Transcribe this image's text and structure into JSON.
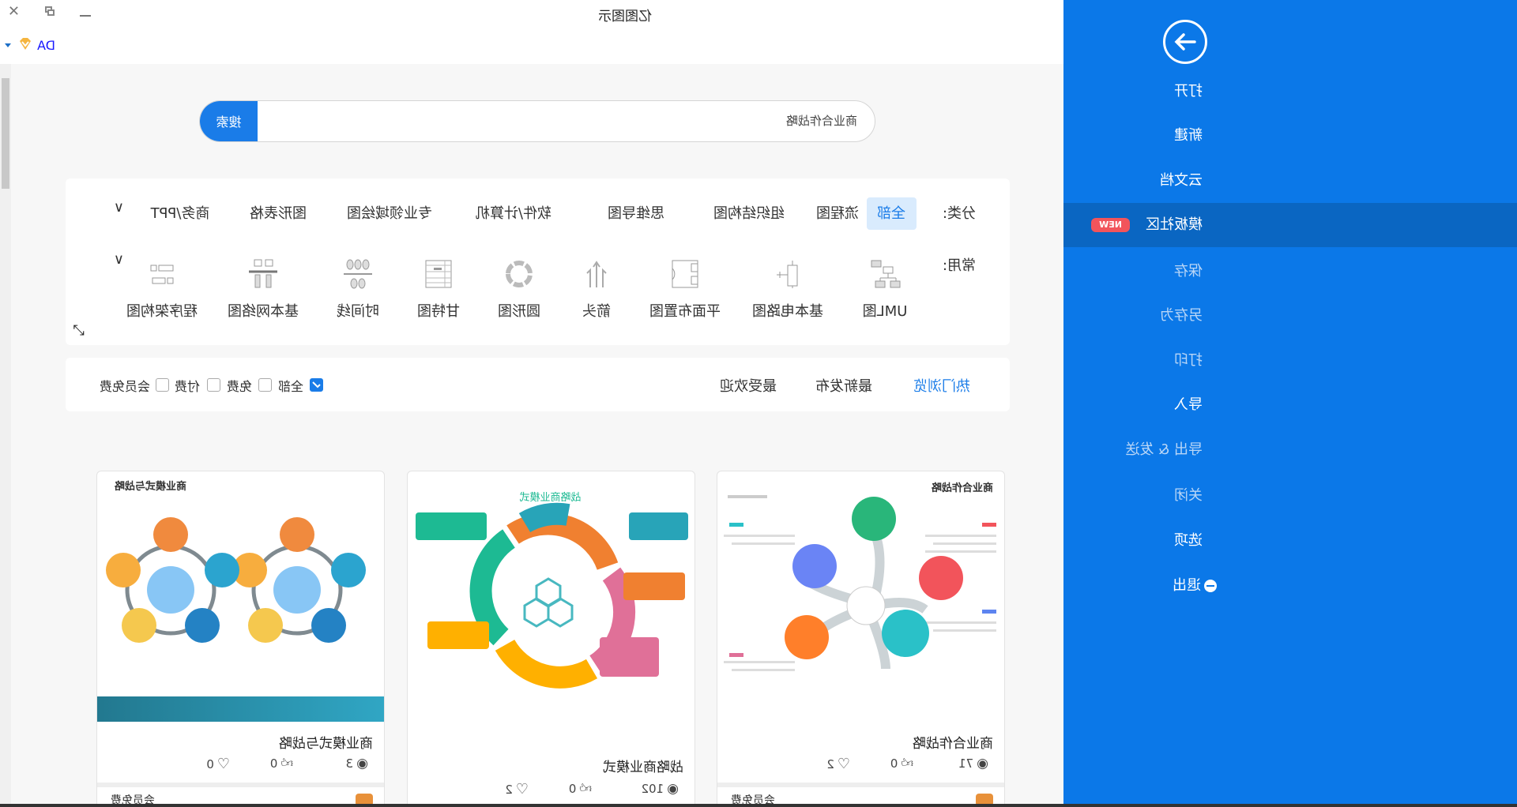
{
  "window": {
    "title": "亿图图示",
    "user": "DA",
    "controls": [
      "minimize",
      "restore",
      "close"
    ]
  },
  "sidebar": {
    "items": [
      {
        "label": "打开",
        "state": "normal"
      },
      {
        "label": "新建",
        "state": "normal"
      },
      {
        "label": "云文档",
        "state": "normal"
      },
      {
        "label": "模板社区",
        "badge": "NEW",
        "state": "active"
      },
      {
        "label": "保存",
        "state": "disabled"
      },
      {
        "label": "另存为",
        "state": "disabled"
      },
      {
        "label": "打印",
        "state": "disabled"
      },
      {
        "label": "导入",
        "state": "normal"
      },
      {
        "label": "导出 & 发送",
        "state": "disabled"
      },
      {
        "label": "关闭",
        "state": "disabled"
      },
      {
        "label": "选项",
        "state": "normal"
      },
      {
        "label": "退出",
        "state": "normal"
      }
    ],
    "color": "#0b78e8"
  },
  "search": {
    "value": "商业合作战略",
    "button": "搜索"
  },
  "categories": {
    "label": "分类:",
    "items": [
      "全部",
      "流程图",
      "组织结构图",
      "思维导图",
      "软件/计算机",
      "专业领域绘图",
      "图形表格",
      "商务/PPT"
    ],
    "selected": "全部"
  },
  "common": {
    "label": "常用:",
    "items": [
      "UML图",
      "基本电路图",
      "平面布置图",
      "箭头",
      "圆形图",
      "甘特图",
      "时间线",
      "基本网络图",
      "程序架构图"
    ]
  },
  "sort": {
    "items": [
      "热门浏览",
      "最新发布",
      "最受欢迎"
    ],
    "selected": "热门浏览"
  },
  "filter": {
    "items": [
      {
        "label": "全部",
        "checked": true
      },
      {
        "label": "免费",
        "checked": false
      },
      {
        "label": "付费",
        "checked": false
      },
      {
        "label": "会员免费",
        "checked": false
      }
    ]
  },
  "cards": [
    {
      "title": "商业合作战略",
      "thumb_title": "商业合作战略",
      "views": "71",
      "likes": "0",
      "favorites": "2",
      "footer": "会员免费"
    },
    {
      "title": "战略商业模式",
      "thumb_title": "战略商业模式",
      "views": "102",
      "likes": "0",
      "favorites": "2"
    },
    {
      "title": "商业模式与战略",
      "thumb_title": "商业模式与战略",
      "views": "3",
      "likes": "0",
      "favorites": "0",
      "footer": "会员免费"
    }
  ]
}
